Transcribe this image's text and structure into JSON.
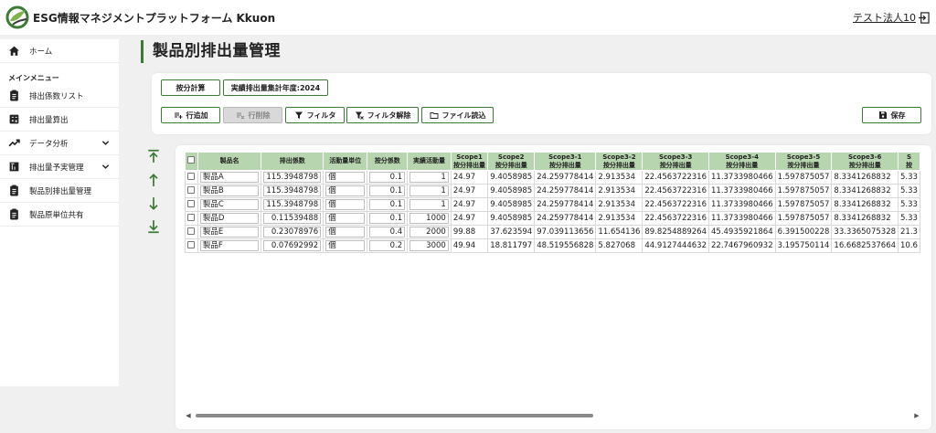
{
  "header": {
    "app_title": "ESG情報マネジメントプラットフォーム Kkuon",
    "user_name": "テスト法人10"
  },
  "sidebar": {
    "home": "ホーム",
    "section_title": "メインメニュー",
    "items": [
      {
        "label": "排出係数リスト"
      },
      {
        "label": "排出量算出"
      },
      {
        "label": "データ分析"
      },
      {
        "label": "排出量予実管理"
      },
      {
        "label": "製品別排出量管理"
      },
      {
        "label": "製品原単位共有"
      }
    ]
  },
  "page": {
    "title": "製品別排出量管理"
  },
  "toolbar1": {
    "allocate_calc": "按分計算",
    "year_label": "実績排出量集計年度:2024"
  },
  "toolbar2": {
    "add_row": "行追加",
    "delete_row": "行削除",
    "filter": "フィルタ",
    "clear_filter": "フィルタ解除",
    "load_file": "ファイル読込",
    "save": "保存"
  },
  "table": {
    "headers": [
      [
        "製品名"
      ],
      [
        "排出係数"
      ],
      [
        "活動量単位"
      ],
      [
        "按分係数"
      ],
      [
        "実績活動量"
      ],
      [
        "Scope1",
        "按分排出量"
      ],
      [
        "Scope2",
        "按分排出量"
      ],
      [
        "Scope3-1",
        "按分排出量"
      ],
      [
        "Scope3-2",
        "按分排出量"
      ],
      [
        "Scope3-3",
        "按分排出量"
      ],
      [
        "Scope3-4",
        "按分排出量"
      ],
      [
        "Scope3-5",
        "按分排出量"
      ],
      [
        "Scope3-6",
        "按分排出量"
      ],
      [
        "S",
        "按"
      ]
    ],
    "rows": [
      [
        "製品A",
        "115.3948798",
        "個",
        "0.1",
        "1",
        "24.97",
        "9.4058985",
        "24.259778414",
        "2.913534",
        "22.4563722316",
        "11.3733980466",
        "1.597875057",
        "8.3341268832",
        "5.33"
      ],
      [
        "製品B",
        "115.3948798",
        "個",
        "0.1",
        "1",
        "24.97",
        "9.4058985",
        "24.259778414",
        "2.913534",
        "22.4563722316",
        "11.3733980466",
        "1.597875057",
        "8.3341268832",
        "5.33"
      ],
      [
        "製品C",
        "115.3948798",
        "個",
        "0.1",
        "1",
        "24.97",
        "9.4058985",
        "24.259778414",
        "2.913534",
        "22.4563722316",
        "11.3733980466",
        "1.597875057",
        "8.3341268832",
        "5.33"
      ],
      [
        "製品D",
        "0.11539488",
        "個",
        "0.1",
        "1000",
        "24.97",
        "9.4058985",
        "24.259778414",
        "2.913534",
        "22.4563722316",
        "11.3733980466",
        "1.597875057",
        "8.3341268832",
        "5.33"
      ],
      [
        "製品E",
        "0.23078976",
        "個",
        "0.4",
        "2000",
        "99.88",
        "37.623594",
        "97.039113656",
        "11.654136",
        "89.8254889264",
        "45.4935921864",
        "6.391500228",
        "33.3365075328",
        "21.3"
      ],
      [
        "製品F",
        "0.07692992",
        "個",
        "0.2",
        "3000",
        "49.94",
        "18.811797",
        "48.519556828",
        "5.827068",
        "44.9127444632",
        "22.7467960932",
        "3.195750114",
        "16.6682537664",
        "10.6"
      ]
    ]
  }
}
